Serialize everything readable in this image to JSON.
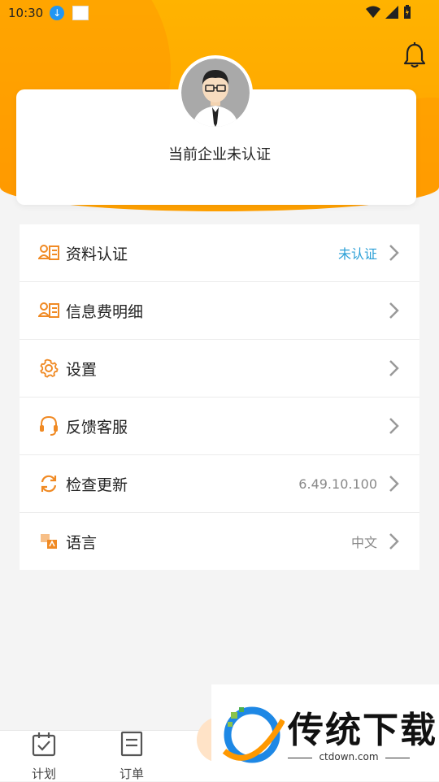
{
  "status_bar": {
    "time": "10:30"
  },
  "profile": {
    "cert_status": "当前企业未认证"
  },
  "menu": {
    "items": [
      {
        "label": "资料认证",
        "value": "未认证",
        "icon": "id-card-icon"
      },
      {
        "label": "信息费明细",
        "value": "",
        "icon": "id-card-icon"
      },
      {
        "label": "设置",
        "value": "",
        "icon": "gear-icon"
      },
      {
        "label": "反馈客服",
        "value": "",
        "icon": "headset-icon"
      },
      {
        "label": "检查更新",
        "value": "6.49.10.100",
        "icon": "refresh-icon"
      },
      {
        "label": "语言",
        "value": "中文",
        "icon": "translate-icon"
      }
    ]
  },
  "tabbar": {
    "tabs": [
      {
        "label": "计划",
        "icon": "calendar-check-icon"
      },
      {
        "label": "订单",
        "icon": "document-icon"
      }
    ]
  },
  "watermark": {
    "title": "传统下载",
    "url": "ctdown.com"
  },
  "colors": {
    "accent": "#ffa000",
    "link": "#2a9fd6",
    "icon_orange": "#f08a24"
  }
}
